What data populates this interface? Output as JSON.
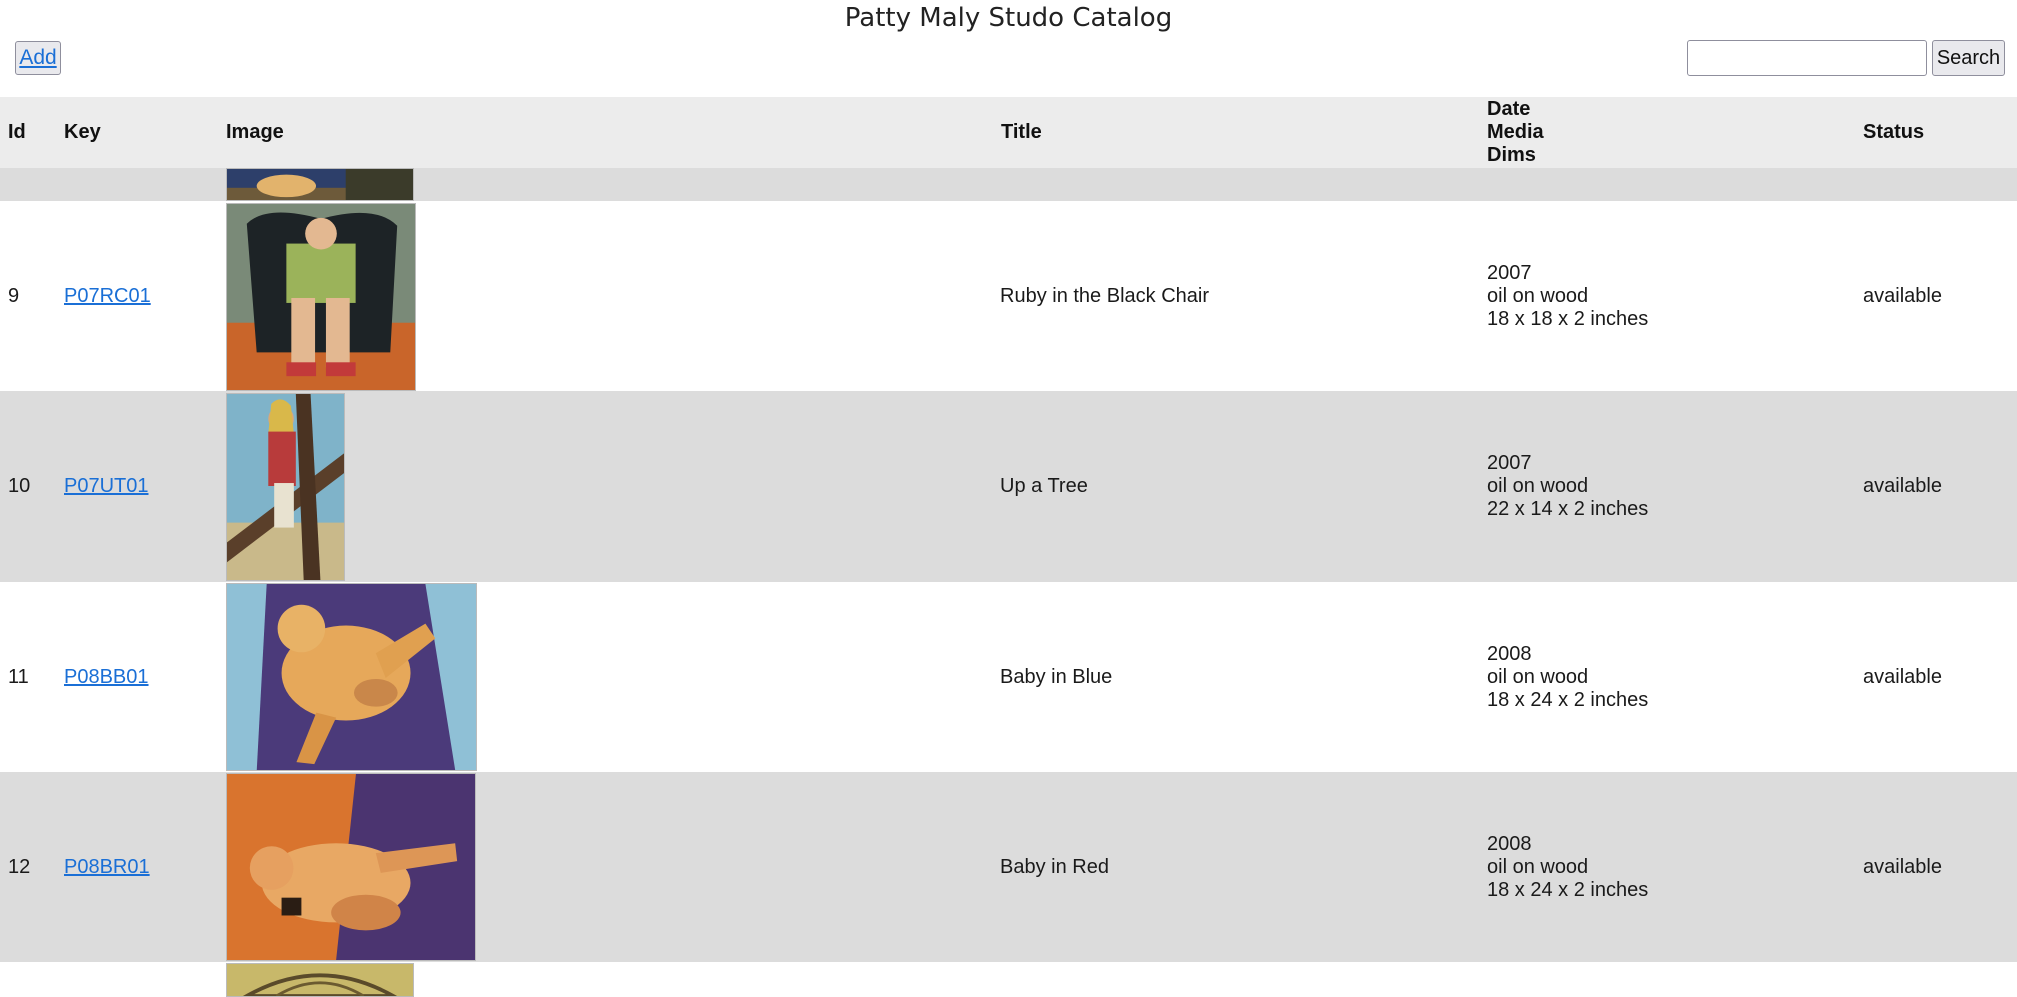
{
  "page": {
    "title": "Patty Maly Studo Catalog"
  },
  "toolbar": {
    "add_label": "Add",
    "search_value": "",
    "search_placeholder": "",
    "search_label": "Search"
  },
  "table": {
    "headers": {
      "id": "Id",
      "key": "Key",
      "image": "Image",
      "title": "Title",
      "date": "Date",
      "media": "Media",
      "dims": "Dims",
      "status": "Status"
    },
    "rows": [
      {
        "id": "9",
        "key": "P07RC01",
        "title": "Ruby in the Black Chair",
        "date": "2007",
        "media": "oil on wood",
        "dims": "18 x 18 x 2 inches",
        "status": "available",
        "image": "painting-girl-in-black-chair"
      },
      {
        "id": "10",
        "key": "P07UT01",
        "title": "Up a Tree",
        "date": "2007",
        "media": "oil on wood",
        "dims": "22 x 14 x 2 inches",
        "status": "available",
        "image": "painting-girl-in-tree"
      },
      {
        "id": "11",
        "key": "P08BB01",
        "title": "Baby in Blue",
        "date": "2008",
        "media": "oil on wood",
        "dims": "18 x 24 x 2 inches",
        "status": "available",
        "image": "painting-baby-blue-background"
      },
      {
        "id": "12",
        "key": "P08BR01",
        "title": "Baby in Red",
        "date": "2008",
        "media": "oil on wood",
        "dims": "18 x 24 x 2 inches",
        "status": "available",
        "image": "painting-baby-red-background"
      }
    ]
  },
  "colors": {
    "link": "#1a6fd6",
    "row_alt": "#dcdcdc",
    "header_bg": "#ececec"
  }
}
